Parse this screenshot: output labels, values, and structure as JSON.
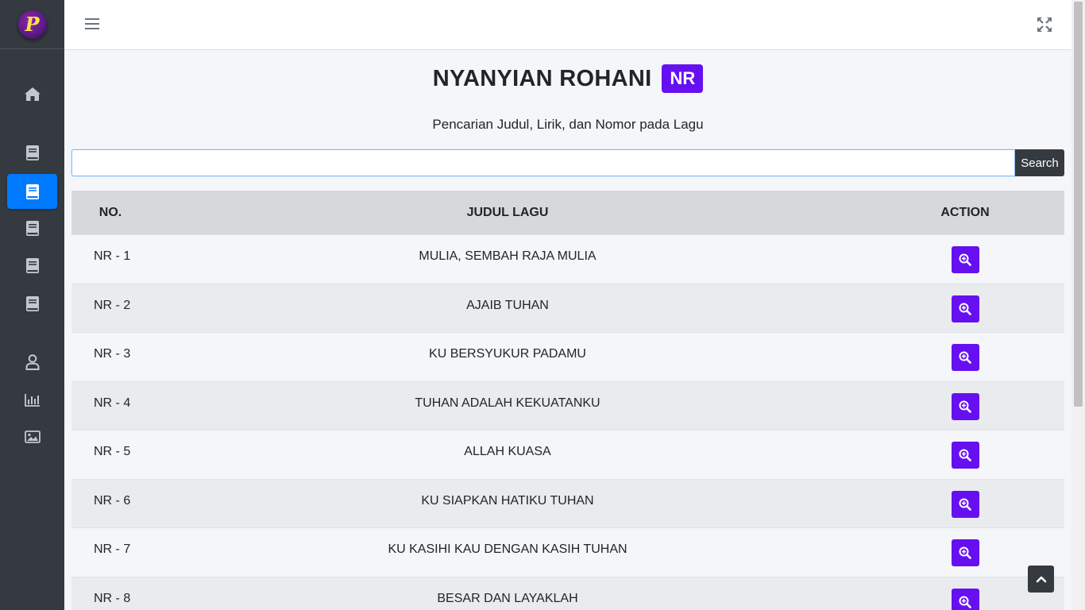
{
  "sidebar": {
    "logo_letter": "P",
    "items": [
      {
        "icon": "home-icon",
        "active": false
      },
      {
        "icon": "book-icon",
        "active": false
      },
      {
        "icon": "book-icon",
        "active": true
      },
      {
        "icon": "book-icon",
        "active": false
      },
      {
        "icon": "book-icon",
        "active": false
      },
      {
        "icon": "book-icon",
        "active": false
      },
      {
        "icon": "user-icon",
        "active": false
      },
      {
        "icon": "chart-bar-icon",
        "active": false
      },
      {
        "icon": "image-icon",
        "active": false
      }
    ]
  },
  "header": {
    "title": "NYANYIAN ROHANI",
    "badge": "NR",
    "subtitle": "Pencarian Judul, Lirik, dan Nomor pada Lagu"
  },
  "search": {
    "value": "",
    "button_label": "Search"
  },
  "table": {
    "columns": [
      "NO.",
      "JUDUL LAGU",
      "ACTION"
    ],
    "rows": [
      {
        "no": "NR - 1",
        "title": "MULIA, SEMBAH RAJA MULIA"
      },
      {
        "no": "NR - 2",
        "title": "AJAIB TUHAN"
      },
      {
        "no": "NR - 3",
        "title": "KU BERSYUKUR PADAMU"
      },
      {
        "no": "NR - 4",
        "title": "TUHAN ADALAH KEKUATANKU"
      },
      {
        "no": "NR - 5",
        "title": "ALLAH KUASA"
      },
      {
        "no": "NR - 6",
        "title": "KU SIAPKAN HATIKU TUHAN"
      },
      {
        "no": "NR - 7",
        "title": "KU KASIHI KAU DENGAN KASIH TUHAN"
      },
      {
        "no": "NR - 8",
        "title": "BESAR DAN LAYAKLAH"
      }
    ]
  },
  "colors": {
    "sidebar_bg": "#343a40",
    "active_item": "#007bff",
    "accent": "#6610f2",
    "header_row": "#d6d8db"
  }
}
